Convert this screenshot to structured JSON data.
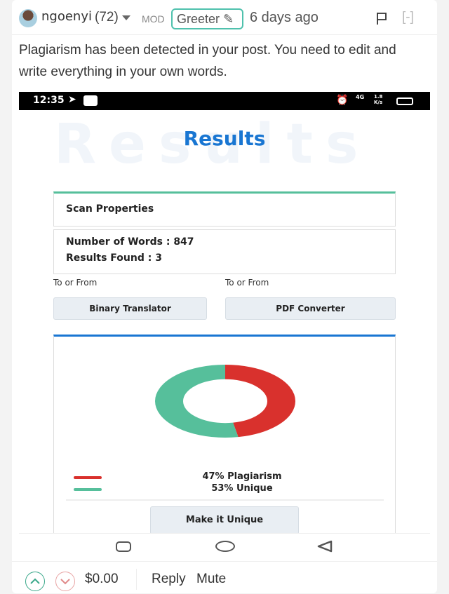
{
  "comment": {
    "username": "ngoenyi",
    "reputation": "(72)",
    "role": "MOD",
    "badge": "Greeter",
    "time": "6 days ago",
    "collapse_label": "[-]",
    "body": "Plagiarism has been detected in your post. You need to edit and write everything in your own words."
  },
  "screenshot": {
    "status_time": "12:35",
    "network": "4G",
    "speed": "1.8 K/s",
    "watermark": "Results",
    "title": "Results",
    "scan_properties": "Scan Properties",
    "words": "Number of Words : 847",
    "results_found": "Results Found : 3",
    "to_from_1": "To or From",
    "to_from_2": "To or From",
    "button_1": "Binary Translator",
    "button_2": "PDF Converter",
    "legend_1": "47% Plagiarism",
    "legend_2": "53% Unique",
    "unique_button": "Make it Unique"
  },
  "chart_data": {
    "type": "pie",
    "categories": [
      "Plagiarism",
      "Unique"
    ],
    "values": [
      47,
      53
    ],
    "colors": [
      "#d9312d",
      "#56bf9b"
    ]
  },
  "footer": {
    "payout": "$0.00",
    "reply": "Reply",
    "mute": "Mute"
  }
}
